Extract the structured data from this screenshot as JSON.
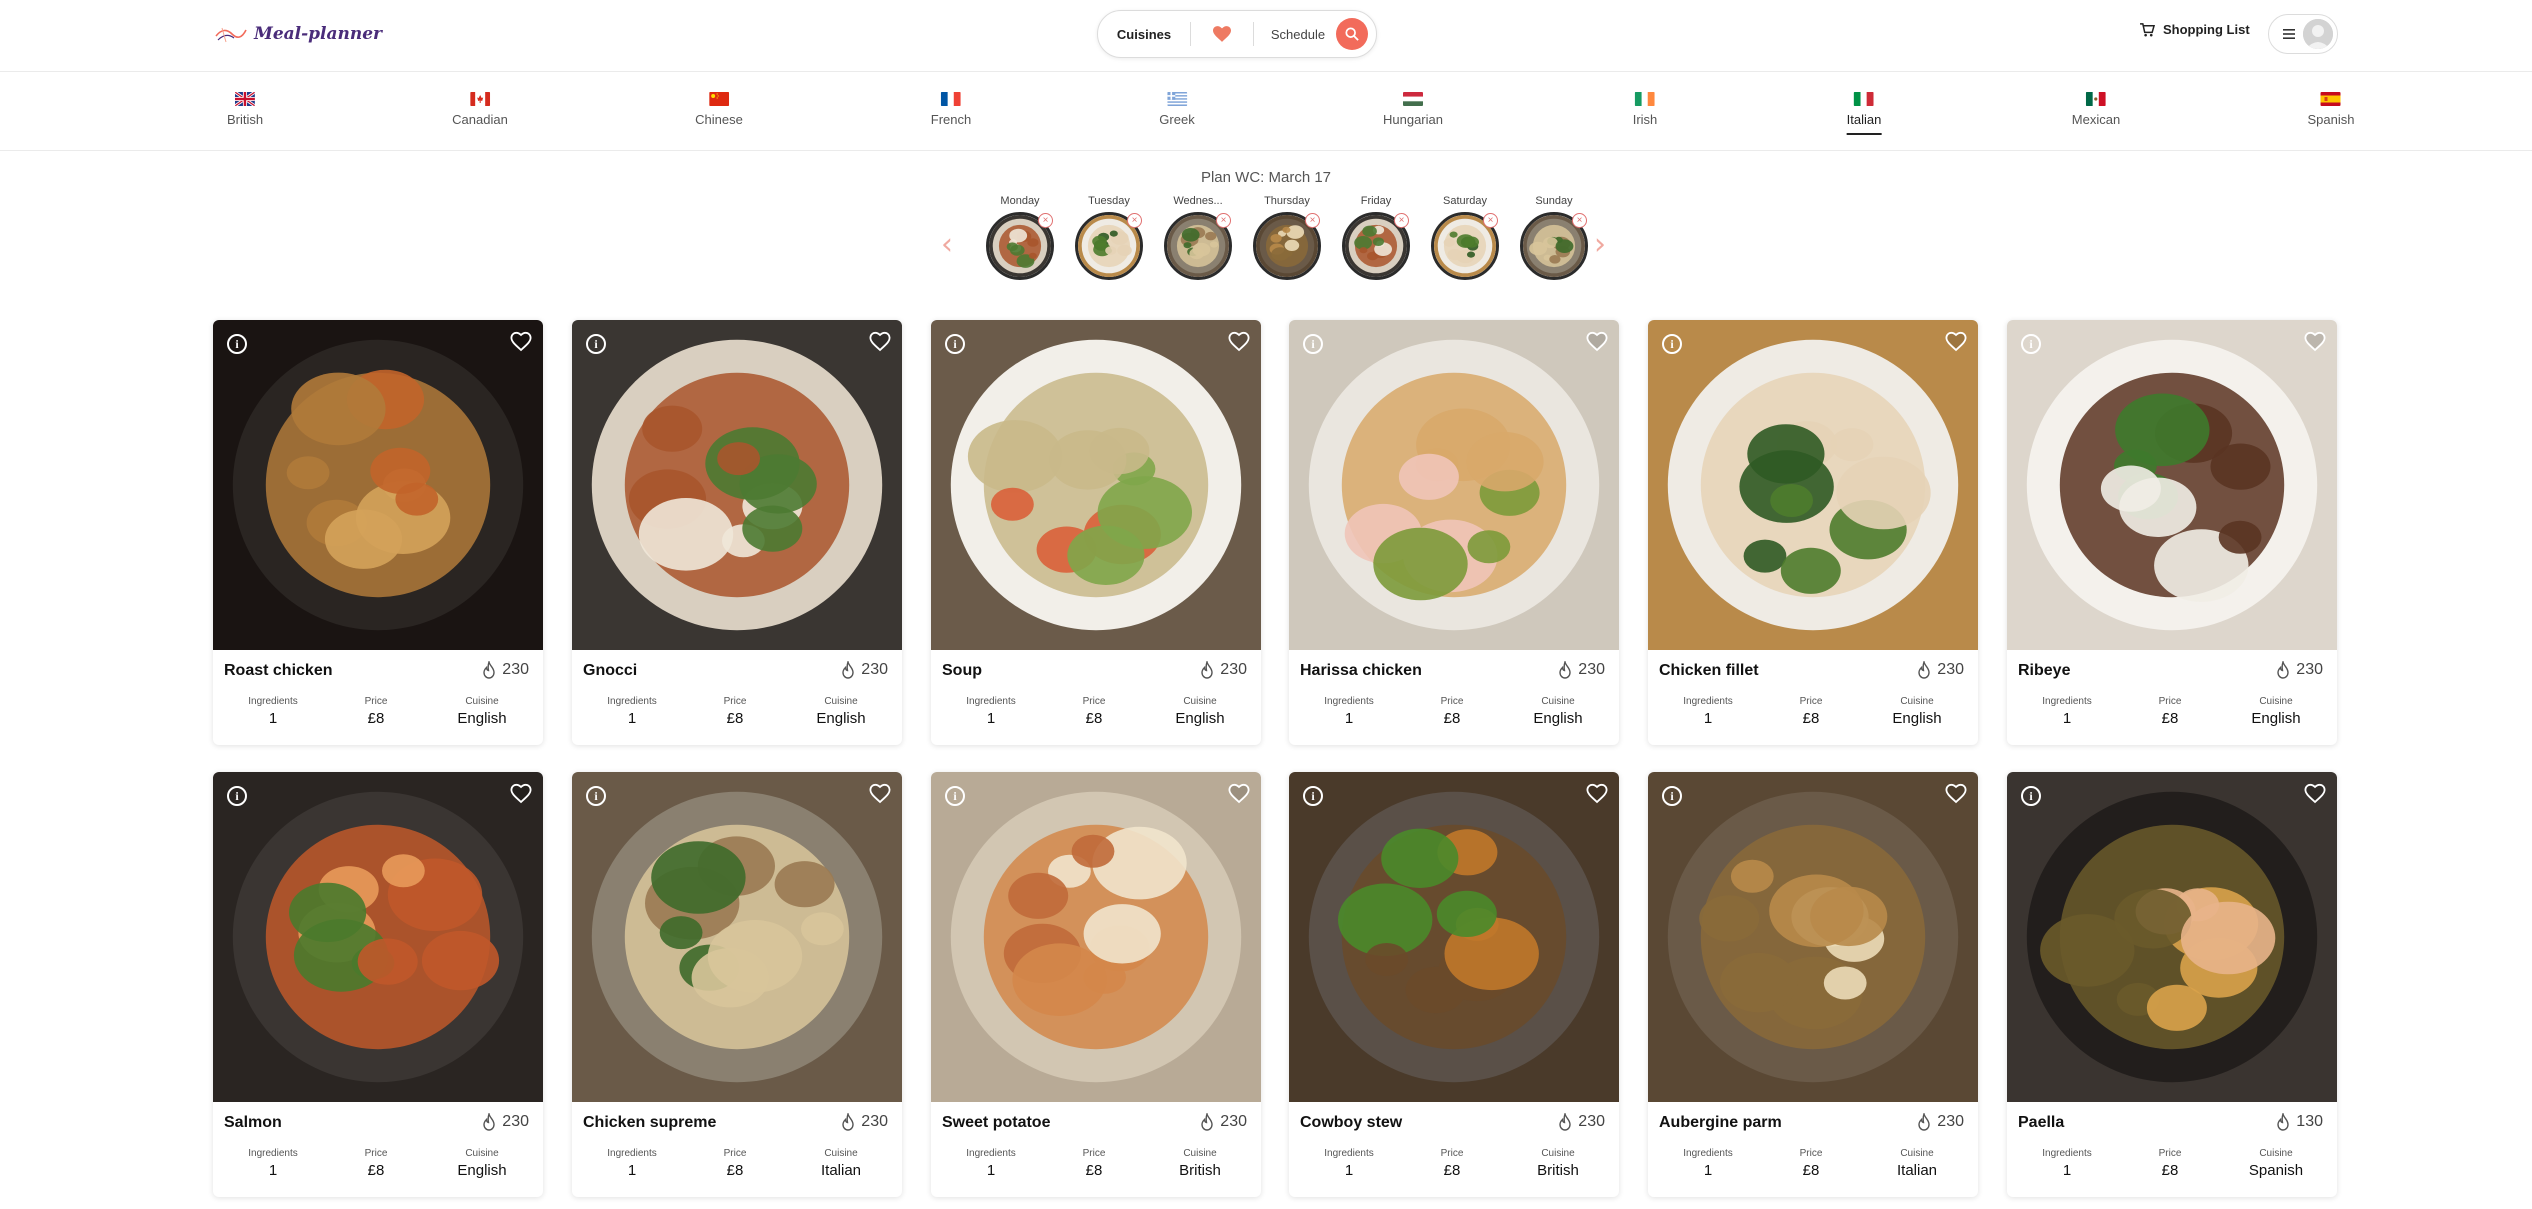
{
  "header": {
    "logo_text": "Meal-planner",
    "search": {
      "cuisines_label": "Cuisines",
      "schedule_label": "Schedule"
    },
    "shopping_list_label": "Shopping List"
  },
  "cuisines": [
    {
      "label": "British",
      "flag": "gb",
      "active": false
    },
    {
      "label": "Canadian",
      "flag": "ca",
      "active": false
    },
    {
      "label": "Chinese",
      "flag": "cn",
      "active": false
    },
    {
      "label": "French",
      "flag": "fr",
      "active": false
    },
    {
      "label": "Greek",
      "flag": "gr",
      "active": false
    },
    {
      "label": "Hungarian",
      "flag": "hu",
      "active": false
    },
    {
      "label": "Irish",
      "flag": "ie",
      "active": false
    },
    {
      "label": "Italian",
      "flag": "it",
      "active": true
    },
    {
      "label": "Mexican",
      "flag": "mx",
      "active": false
    },
    {
      "label": "Spanish",
      "flag": "es",
      "active": false
    }
  ],
  "plan": {
    "title": "Plan WC: March 17",
    "days": [
      {
        "label": "Monday"
      },
      {
        "label": "Tuesday"
      },
      {
        "label": "Wednes..."
      },
      {
        "label": "Thursday"
      },
      {
        "label": "Friday"
      },
      {
        "label": "Saturday"
      },
      {
        "label": "Sunday"
      }
    ]
  },
  "meta_labels": {
    "ingredients": "Ingredients",
    "price": "Price",
    "cuisine": "Cuisine"
  },
  "recipes": [
    {
      "title": "Roast chicken",
      "calories": "230",
      "ingredients": "1",
      "price": "£8",
      "cuisine": "English"
    },
    {
      "title": "Gnocci",
      "calories": "230",
      "ingredients": "1",
      "price": "£8",
      "cuisine": "English"
    },
    {
      "title": "Soup",
      "calories": "230",
      "ingredients": "1",
      "price": "£8",
      "cuisine": "English"
    },
    {
      "title": "Harissa chicken",
      "calories": "230",
      "ingredients": "1",
      "price": "£8",
      "cuisine": "English"
    },
    {
      "title": "Chicken fillet",
      "calories": "230",
      "ingredients": "1",
      "price": "£8",
      "cuisine": "English"
    },
    {
      "title": "Ribeye",
      "calories": "230",
      "ingredients": "1",
      "price": "£8",
      "cuisine": "English"
    },
    {
      "title": "Salmon",
      "calories": "230",
      "ingredients": "1",
      "price": "£8",
      "cuisine": "English"
    },
    {
      "title": "Chicken supreme",
      "calories": "230",
      "ingredients": "1",
      "price": "£8",
      "cuisine": "Italian"
    },
    {
      "title": "Sweet potatoe",
      "calories": "230",
      "ingredients": "1",
      "price": "£8",
      "cuisine": "British"
    },
    {
      "title": "Cowboy stew",
      "calories": "230",
      "ingredients": "1",
      "price": "£8",
      "cuisine": "British"
    },
    {
      "title": "Aubergine parm",
      "calories": "230",
      "ingredients": "1",
      "price": "£8",
      "cuisine": "Italian"
    },
    {
      "title": "Paella",
      "calories": "130",
      "ingredients": "1",
      "price": "£8",
      "cuisine": "Spanish"
    }
  ],
  "colors": {
    "accent": "#f26b5b",
    "heart": "#ee7a62"
  }
}
